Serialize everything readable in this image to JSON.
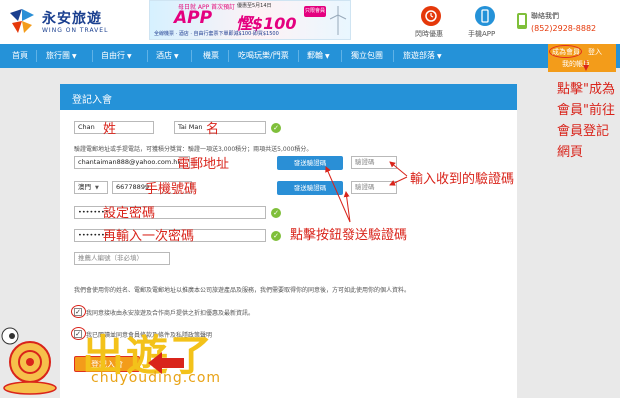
{
  "header": {
    "logo_zh": "永安旅遊",
    "logo_en": "WING ON TRAVEL",
    "banner": {
      "top": "母日就 APP 首次預訂",
      "date": "優惠至5月14日",
      "app": "APP",
      "discount": "慳$100",
      "tag": "只限會員",
      "sub": "全線機票 · 酒店 · 自由行套票下單即減$100·即買$1500"
    },
    "promo_label": "閃時優惠",
    "app_label": "手機APP",
    "contact_label": "聯絡我們",
    "contact_phone": "(852)2928-8882"
  },
  "nav": {
    "items": [
      "首頁",
      "旅行團",
      "自由行",
      "酒店",
      "機票",
      "吃喝玩樂/門票",
      "郵輪",
      "獨立包團",
      "旅遊部落"
    ],
    "login": "成為會員",
    "register": "登入",
    "my_account": "我的帳戶"
  },
  "form": {
    "title": "登記入會",
    "surname_value": "Chan",
    "given_name_value": "Tai Man",
    "verify_hint": "驗證電郵地址或手提電話，可獲積分獎賞：驗證一項送3,000積分；兩項共送5,000積分。",
    "email_value": "chantaiman888@yahoo.com.hk",
    "send_code_label": "發送驗證碼",
    "code_placeholder": "驗證碼",
    "region_value": "澳門",
    "phone_value": "66778899",
    "password_value": "••••••••",
    "password_confirm_value": "••••••••",
    "referral_placeholder": "推薦人編號（非必填）",
    "privacy_text": "我們會使用你的姓名、電郵及電郵地址以推廣本公司旅遊產品及服務，我們需要取得你的同意後，方可如此使用你的個人資料。",
    "agree_promo_text": "我同意接收由永安旅遊及合作商戶提供之折扣優惠及最新資訊。",
    "agree_terms_text": "我已閱讀並同意會員條款及條件及私隱政策聲明",
    "submit_label": "登記入會"
  },
  "annotations": {
    "surname": "姓",
    "given_name": "名",
    "email": "電郵地址",
    "phone": "手機號碼",
    "password": "設定密碼",
    "password_confirm": "再輸入一次密碼",
    "enter_code": "輸入收到的驗證碼",
    "click_send": "點擊按鈕發送驗證碼",
    "side_note": [
      "點擊\"成為",
      "會員\"前往",
      "會員登記",
      "網頁"
    ]
  },
  "watermark": {
    "zh": "出遊了",
    "en": "chuyouding.com"
  },
  "colors": {
    "nav_blue": "#2592d8",
    "orange": "#f39c1a",
    "annotation_red": "#d9241b",
    "check_green": "#7fbf3a"
  }
}
